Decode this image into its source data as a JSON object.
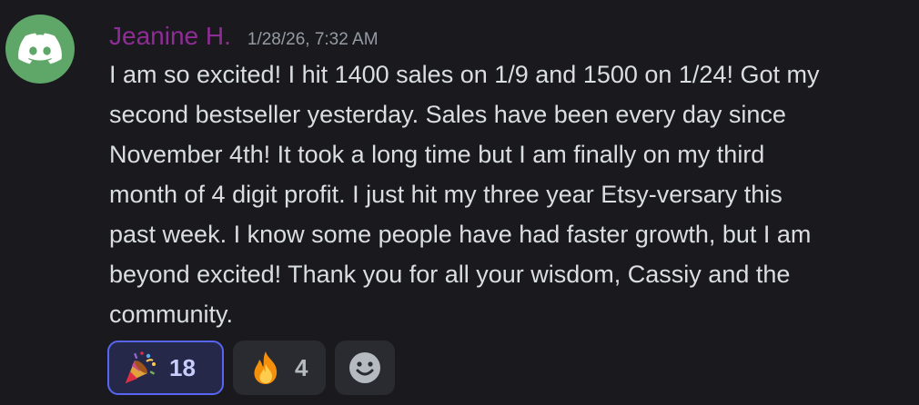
{
  "message": {
    "username": "Jeanine H.",
    "timestamp": "1/28/26, 7:32 AM",
    "lines": [
      "I am so excited!  I hit 1400 sales on 1/9 and 1500 on 1/24!  Got my",
      "second bestseller yesterday.  Sales have been every day since",
      "November 4th!  It took a long time but I am finally on my third",
      "month of 4 digit profit.  I just hit my three year Etsy-versary this",
      "past week.  I know some people have had faster growth, but I am",
      "beyond excited!  Thank you for all your wisdom, Cassiy and the",
      "community."
    ],
    "avatar_icon": "discord-logo-icon",
    "avatar_color": "#5fa768",
    "username_color": "#8f2c96"
  },
  "reactions": [
    {
      "emoji": "party-popper-icon",
      "count": "18",
      "active": true
    },
    {
      "emoji": "fire-icon",
      "count": "4",
      "active": false
    }
  ],
  "add_reaction": {
    "icon": "smiley-add-reaction-icon"
  },
  "colors": {
    "background": "#1a1a1e",
    "text": "#dbdee1",
    "accent": "#5865f2"
  }
}
